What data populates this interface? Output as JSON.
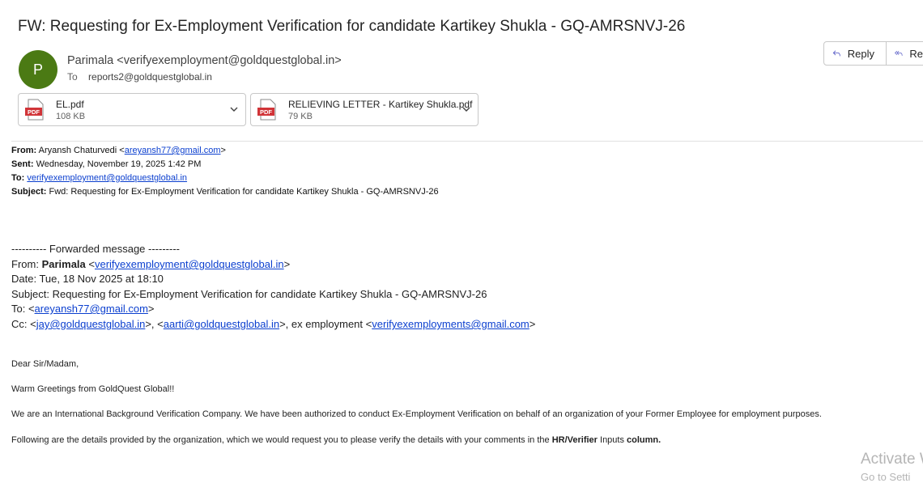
{
  "email": {
    "subject": "FW: Requesting for Ex-Employment Verification for candidate Kartikey Shukla - GQ-AMRSNVJ-26",
    "avatar_letter": "P",
    "avatar_color": "#4b7a14",
    "sender": "Parimala <verifyexemployment@goldquestglobal.in>",
    "to_label": "To",
    "to_value": "reports2@goldquestglobal.in"
  },
  "actions": {
    "reply_label": "Reply",
    "reply_all_label": "Re"
  },
  "attachments": [
    {
      "name": "EL.pdf",
      "size": "108 KB",
      "icon": "pdf-icon"
    },
    {
      "name": "RELIEVING LETTER - Kartikey Shukla.pdf",
      "size": "79 KB",
      "icon": "pdf-icon"
    }
  ],
  "forward_header": {
    "from_label": "From:",
    "from_name": "Aryansh Chaturvedi <",
    "from_email": "areyansh77@gmail.com",
    "from_end": ">",
    "sent_label": "Sent:",
    "sent_value": "Wednesday, November 19, 2025 1:42 PM",
    "to_label": "To:",
    "to_email": "verifyexemployment@goldquestglobal.in",
    "subject_label": "Subject:",
    "subject_value": "Fwd: Requesting for Ex-Employment Verification for candidate Kartikey Shukla - GQ-AMRSNVJ-26"
  },
  "forwarded": {
    "separator": "---------- Forwarded message ---------",
    "from_label": "From: ",
    "from_name": "Parimala",
    "from_email": "verifyexemployment@goldquestglobal.in",
    "date": "Date: Tue, 18 Nov 2025 at 18:10",
    "subject": "Subject: Requesting for Ex-Employment Verification for candidate Kartikey Shukla - GQ-AMRSNVJ-26",
    "to_label": "To: <",
    "to_email": "areyansh77@gmail.com",
    "cc_label": "Cc: <",
    "cc_email1": "jay@goldquestglobal.in",
    "cc_email2": "aarti@goldquestglobal.in",
    "cc_text3": ">, ex employment <",
    "cc_email3": "verifyexemployments@gmail.com"
  },
  "body": {
    "greeting": "Dear Sir/Madam,",
    "warm": "Warm Greetings from GoldQuest Global!!",
    "para1": "We are an International Background Verification Company. We have been authorized to conduct Ex-Employment Verification on behalf of an organization of your Former Employee for employment purposes.",
    "para2_start": "Following are the details provided by the organization, which we would request you to please verify the details with your comments in the ",
    "para2_bold": "HR/Verifier",
    "para2_mid": " Inputs ",
    "para2_end": "column."
  },
  "watermark": {
    "line1": "Activate W",
    "line2": "Go to Setti"
  }
}
